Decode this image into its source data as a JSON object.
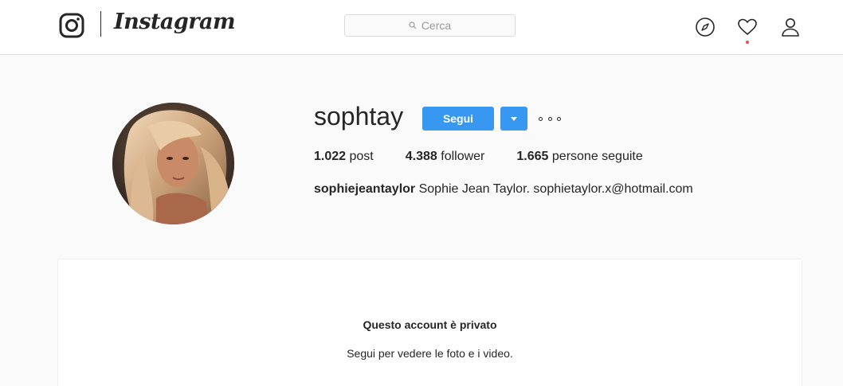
{
  "header": {
    "wordmark": "Instagram",
    "search": {
      "placeholder": "Cerca"
    },
    "nav_icons": [
      "instagram-glyph-icon",
      "compass-icon",
      "heart-icon",
      "user-icon"
    ],
    "has_activity_notification": true
  },
  "profile": {
    "username": "sophtay",
    "follow_label": "Segui",
    "stats": [
      {
        "value": "1.022",
        "label": "post"
      },
      {
        "value": "4.388",
        "label": "follower"
      },
      {
        "value": "1.665",
        "label": "persone seguite"
      }
    ],
    "bio": {
      "name": "sophiejeantaylor",
      "text": "Sophie Jean Taylor. sophietaylor.x@hotmail.com"
    }
  },
  "private_notice": {
    "title": "Questo account è privato",
    "subtitle": "Segui per vedere le foto e i video."
  },
  "colors": {
    "accent": "#3897f0",
    "background": "#fafafa",
    "text": "#262626",
    "notification": "#ed4956"
  }
}
